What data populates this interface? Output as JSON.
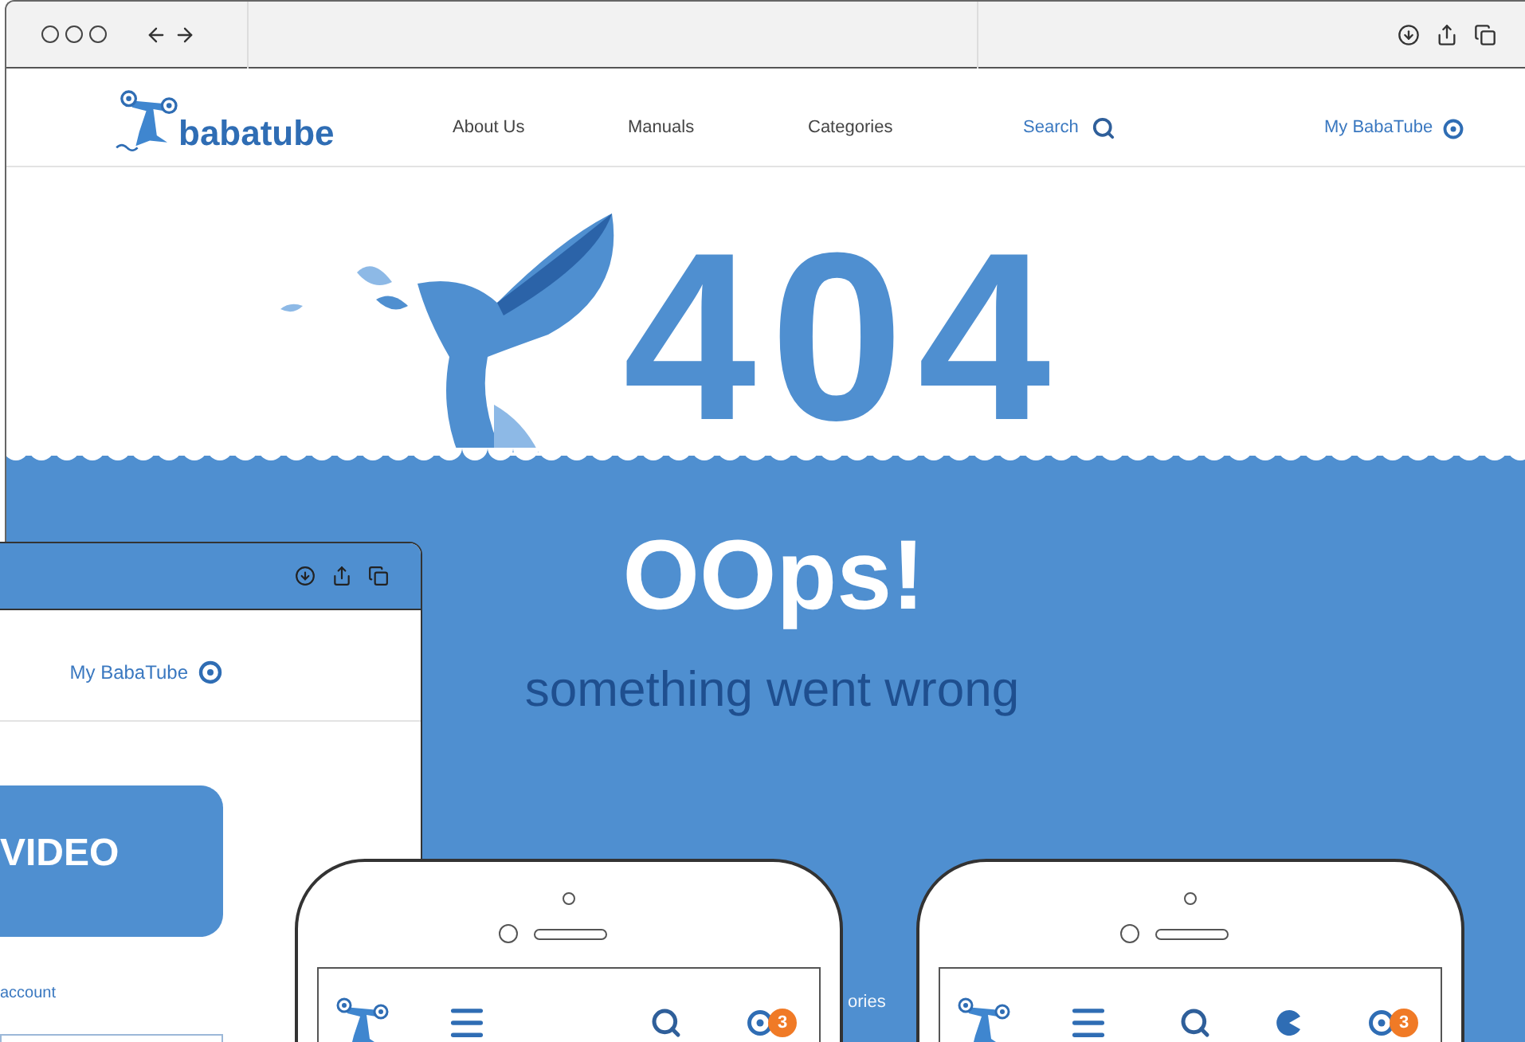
{
  "browser": {
    "logo": "babatube",
    "nav": [
      {
        "label": "About Us",
        "kind": "plain"
      },
      {
        "label": "Manuals",
        "kind": "plain"
      },
      {
        "label": "Categories",
        "kind": "plain"
      },
      {
        "label": "Search",
        "kind": "search"
      },
      {
        "label": "My BabaTube",
        "kind": "account"
      }
    ]
  },
  "hero": {
    "code": "404",
    "title": "OOps!",
    "message": "something went wrong"
  },
  "tablet": {
    "account_link": "My BabaTube",
    "video_button": "VIDEO",
    "link": "account"
  },
  "behind_text": "ories",
  "phones": [
    {
      "items": [
        {
          "kind": "menu"
        },
        {
          "kind": "search"
        },
        {
          "kind": "badge"
        }
      ],
      "badge": "3"
    },
    {
      "items": [
        {
          "kind": "menu"
        },
        {
          "kind": "search"
        },
        {
          "kind": "pacman"
        },
        {
          "kind": "badge"
        }
      ],
      "badge": "3"
    }
  ]
}
